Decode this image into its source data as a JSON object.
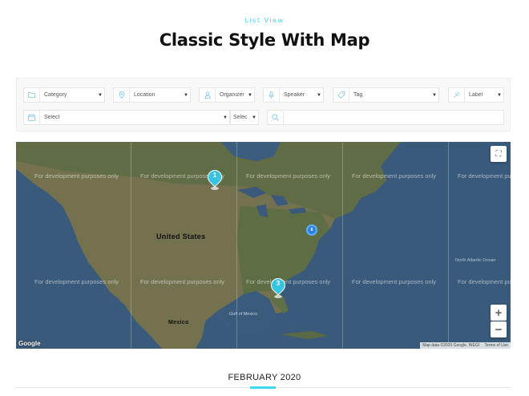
{
  "header": {
    "eyebrow": "List View",
    "title": "Classic Style With Map"
  },
  "filters": {
    "category": "Category",
    "location": "Location",
    "organizer": "Organizer",
    "speaker": "Speaker",
    "tag": "Tag",
    "label": "Label",
    "select_main": "Select",
    "select_small": "Selec",
    "search_value": ""
  },
  "map": {
    "dev_watermark": "For development purposes only",
    "country_us": "United States",
    "country_mexico": "Mexico",
    "gulf": "Gulf of Mexico",
    "atlantic": "North Atlantic Ocean",
    "google_logo": "Google",
    "attribution": "Map data ©2020 Google, INEGI",
    "terms": "Terms of Use",
    "zoom_in": "+",
    "zoom_out": "−",
    "marker_1": "1",
    "marker_3": "3",
    "cluster": "8"
  },
  "calendar": {
    "month": "FEBRUARY 2020"
  },
  "colors": {
    "accent": "#40d9f1",
    "marker": "#37c4e1",
    "ocean": "#3a5a7b",
    "land": "#7a7a52"
  },
  "icons": [
    "folder-icon",
    "location-pin-icon",
    "user-icon",
    "microphone-icon",
    "tag-icon",
    "label-icon",
    "calendar-icon",
    "search-icon",
    "fullscreen-icon"
  ]
}
